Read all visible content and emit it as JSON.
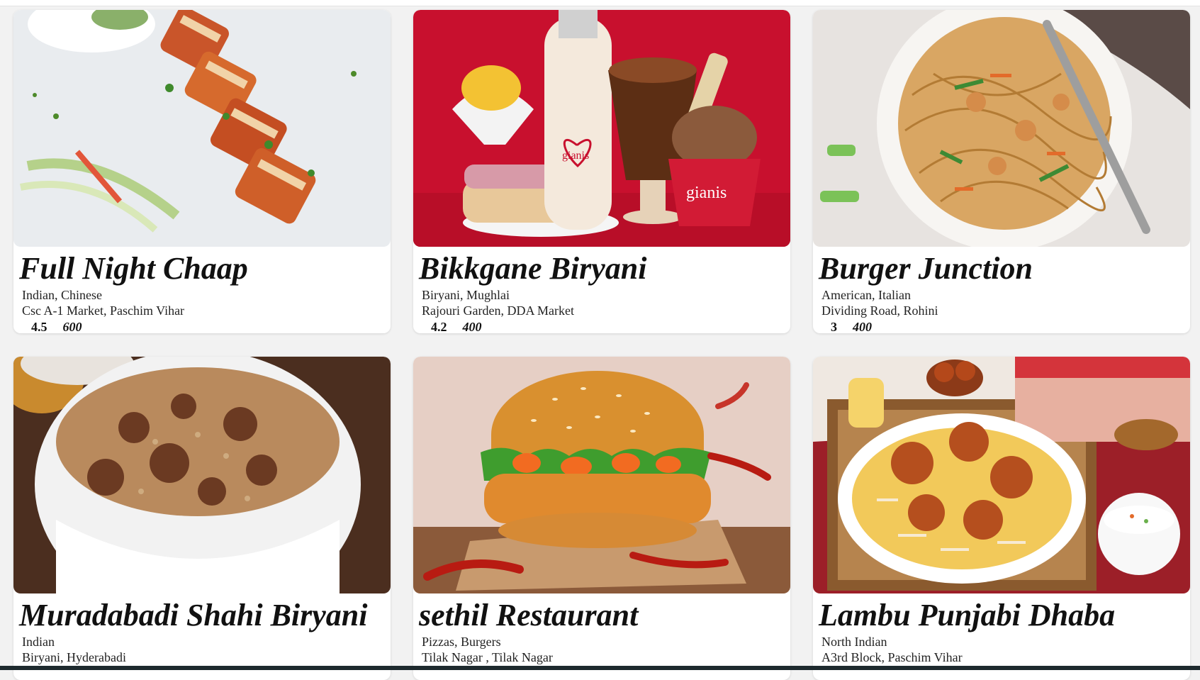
{
  "restaurants": [
    {
      "name": "Full Night Chaap",
      "cuisines": "Indian, Chinese",
      "address": "Csc A-1 Market, Paschim Vihar",
      "rating": "4.5",
      "price": "600",
      "image": "paneer-tikka-photo"
    },
    {
      "name": "Bikkgane Biryani",
      "cuisines": "Biryani, Mughlai",
      "address": "Rajouri Garden, DDA Market",
      "rating": "4.2",
      "price": "400",
      "image": "gianis-dessert-photo",
      "brand_text": "gianis"
    },
    {
      "name": "Burger Junction",
      "cuisines": "American, Italian",
      "address": "Dividing Road, Rohini",
      "rating": "3",
      "price": "400",
      "image": "noodles-bowl-photo"
    },
    {
      "name": "Muradabadi Shahi Biryani",
      "cuisines": "Indian",
      "address": "Biryani, Hyderabadi",
      "image": "biryani-bowl-photo"
    },
    {
      "name": "sethil Restaurant",
      "cuisines": "Pizzas, Burgers",
      "address": "Tilak Nagar , Tilak Nagar",
      "image": "chicken-burger-photo"
    },
    {
      "name": "Lambu Punjabi Dhaba",
      "cuisines": "North Indian",
      "address": "A3rd Block, Paschim Vihar",
      "image": "chicken-biryani-platter-photo"
    }
  ],
  "colors": {
    "gianis_red": "#c8102e",
    "card_bg": "#ffffff",
    "page_bg": "#f2f2f2"
  }
}
